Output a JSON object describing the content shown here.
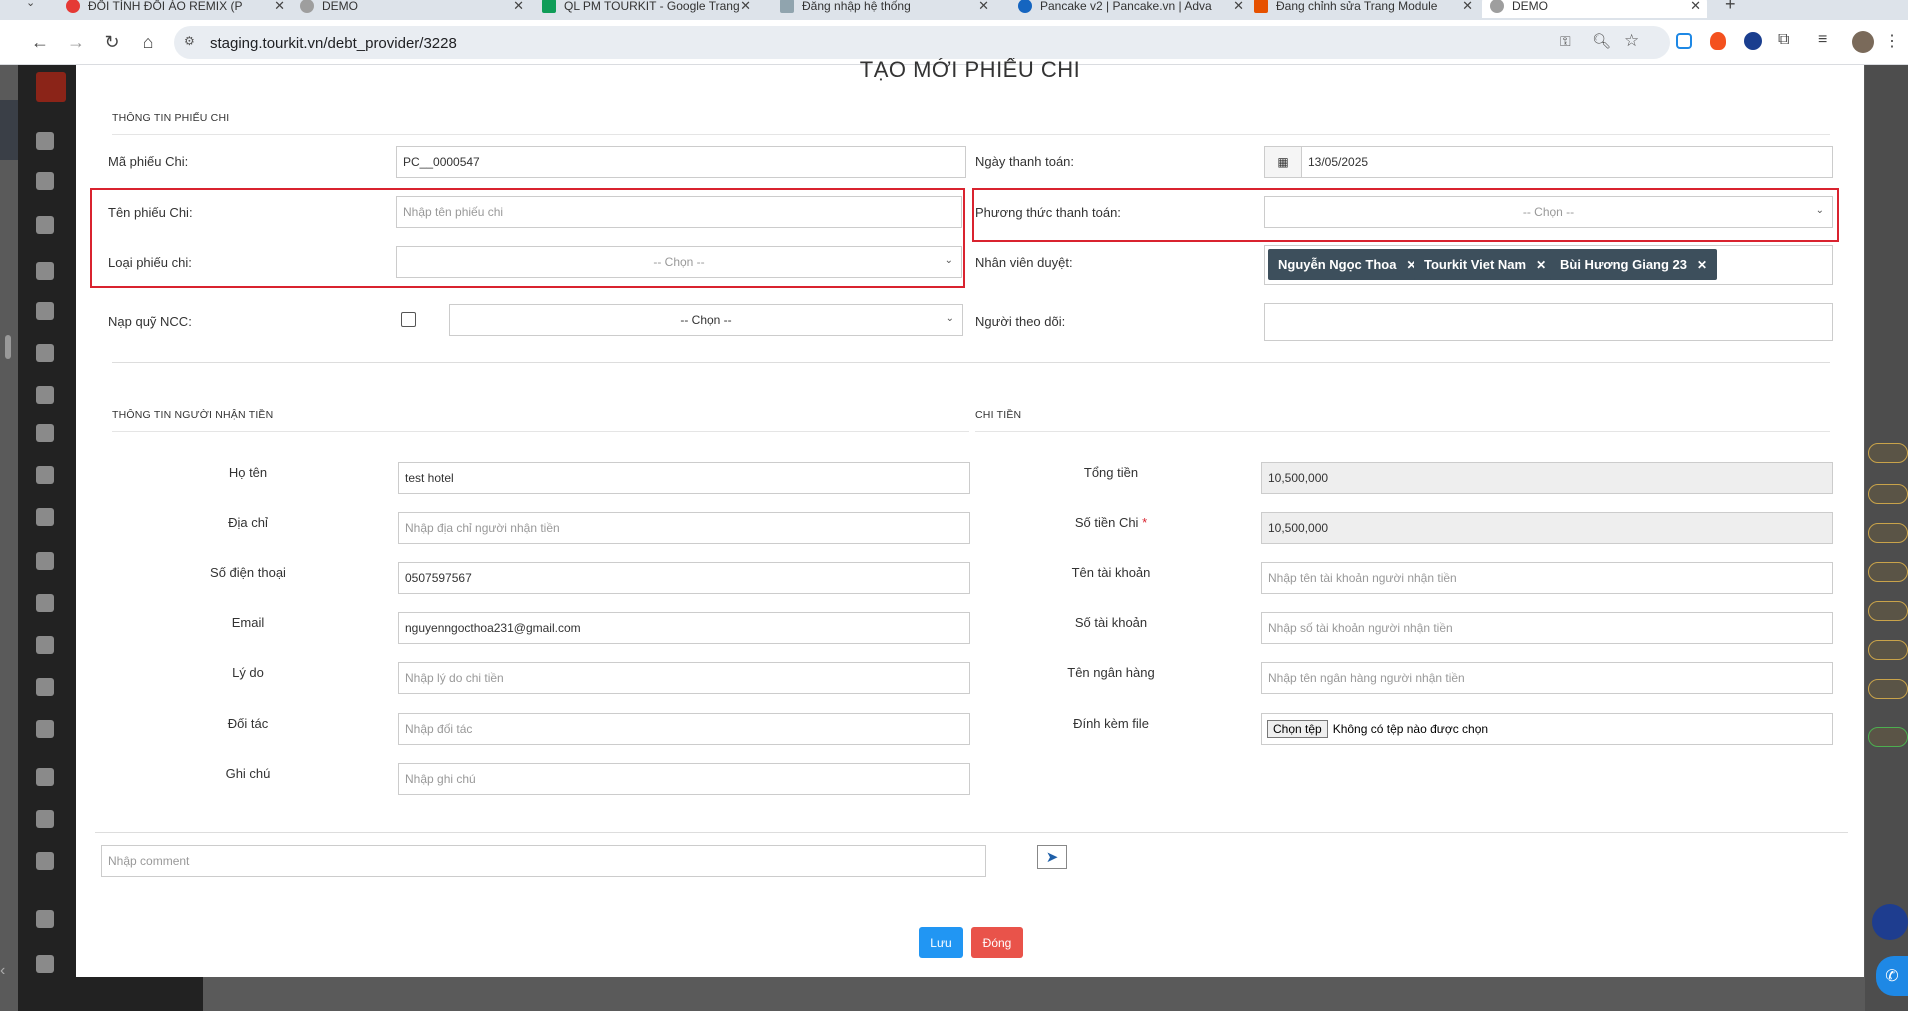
{
  "browser": {
    "tabs": [
      {
        "title": "ĐỐI TÌNH ĐỐI ÁO REMIX (P",
        "color": "#e53935"
      },
      {
        "title": "DEMO",
        "color": "#9e9e9e"
      },
      {
        "title": "QL PM TOURKIT - Google Trang",
        "color": "#0f9d58"
      },
      {
        "title": "Đăng nhập hệ thống",
        "color": "#90a4ae"
      },
      {
        "title": "Pancake v2 | Pancake.vn | Adva",
        "color": "#1565c0"
      },
      {
        "title": "Đang chỉnh sửa Trang Module",
        "color": "#e65100"
      },
      {
        "title": "DEMO",
        "color": "#9e9e9e"
      }
    ],
    "url": "staging.tourkit.vn/debt_provider/3228"
  },
  "modal": {
    "title": "TẠO MỚI PHIẾU CHI",
    "section_info": "THÔNG TIN PHIẾU CHI",
    "ma_phieu_label": "Mã phiếu Chi:",
    "ma_phieu_value": "PC__0000547",
    "ngay_tt_label": "Ngày thanh toán:",
    "ngay_tt_value": "13/05/2025",
    "ten_phieu_label": "Tên phiếu Chi:",
    "ten_phieu_placeholder": "Nhập tên phiếu chi",
    "pttt_label": "Phương thức thanh toán:",
    "pttt_value": "-- Chọn --",
    "loai_phieu_label": "Loại phiếu chi:",
    "loai_phieu_value": "-- Chọn --",
    "nv_duyet_label": "Nhân viên duyệt:",
    "nv_duyet_tags": [
      "Nguyễn Ngọc Thoa",
      "Tourkit Viet Nam",
      "Bùi Hương Giang 23"
    ],
    "nap_quy_label": "Nạp quỹ NCC:",
    "nap_quy_value": "-- Chọn --",
    "nguoi_theo_doi_label": "Người theo dõi:",
    "section_recipient": "THÔNG TIN NGƯỜI NHẬN TIỀN",
    "section_payment": "CHI TIỀN",
    "ho_ten_label": "Họ tên",
    "ho_ten_value": "test hotel",
    "dia_chi_label": "Địa chỉ",
    "dia_chi_placeholder": "Nhập địa chỉ người nhận tiền",
    "sdt_label": "Số điện thoại",
    "sdt_value": "0507597567",
    "email_label": "Email",
    "email_value": "nguyenngocthoa231@gmail.com",
    "ly_do_label": "Lý do",
    "ly_do_placeholder": "Nhập lý do chi tiền",
    "doi_tac_label": "Đối tác",
    "doi_tac_placeholder": "Nhập đối tác",
    "ghi_chu_label": "Ghi chú",
    "ghi_chu_placeholder": "Nhập ghi chú",
    "tong_tien_label": "Tổng tiền",
    "tong_tien_value": "10,500,000",
    "so_tien_chi_label": "Số tiền Chi",
    "so_tien_chi_required": "*",
    "so_tien_chi_value": "10,500,000",
    "ten_tk_label": "Tên tài khoản",
    "ten_tk_placeholder": "Nhập tên tài khoản người nhận tiền",
    "so_tk_label": "Số tài khoản",
    "so_tk_placeholder": "Nhập số tài khoản người nhận tiền",
    "ngan_hang_label": "Tên ngân hàng",
    "ngan_hang_placeholder": "Nhập tên ngân hàng người nhận tiền",
    "dinh_kem_label": "Đính kèm file",
    "file_button": "Chọn tệp",
    "file_status": "Không có tệp nào được chọn",
    "comment_placeholder": "Nhập comment",
    "save_label": "Lưu",
    "close_label": "Đóng"
  }
}
